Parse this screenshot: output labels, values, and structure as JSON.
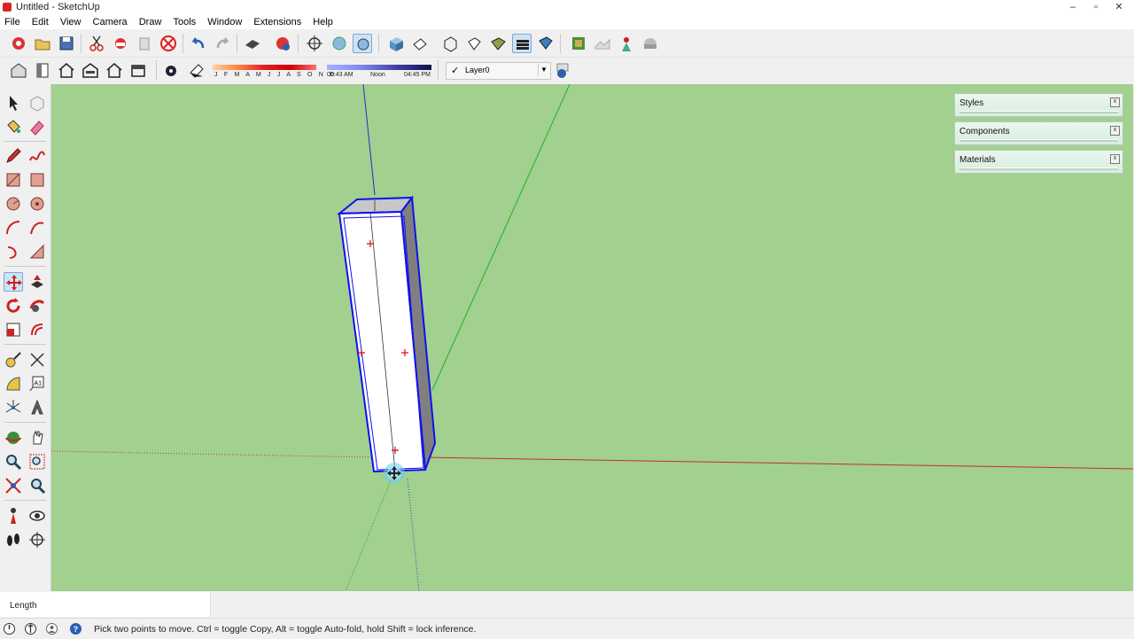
{
  "window": {
    "title": "Untitled - SketchUp",
    "min": "–",
    "max": "▫",
    "close": "✕"
  },
  "menu": [
    "File",
    "Edit",
    "View",
    "Camera",
    "Draw",
    "Tools",
    "Window",
    "Extensions",
    "Help"
  ],
  "shadows": {
    "months": "J F M A M J J A S O N D",
    "time_start": "06:43 AM",
    "time_mid": "Noon",
    "time_end": "04:45 PM"
  },
  "layer": {
    "check": "✓",
    "name": "Layer0"
  },
  "trays": [
    {
      "label": "Styles"
    },
    {
      "label": "Components"
    },
    {
      "label": "Materials"
    }
  ],
  "tray_close": "x",
  "vcb": {
    "label": "Length"
  },
  "status": {
    "message": "Pick two points to move.  Ctrl = toggle Copy, Alt = toggle Auto-fold, hold Shift = lock inference."
  },
  "colors": {
    "viewport": "#a2d08f",
    "red_axis": "#c0302a",
    "green_axis": "#1fb31f",
    "blue_axis": "#2a2ad0",
    "selection": "#1010ee"
  }
}
